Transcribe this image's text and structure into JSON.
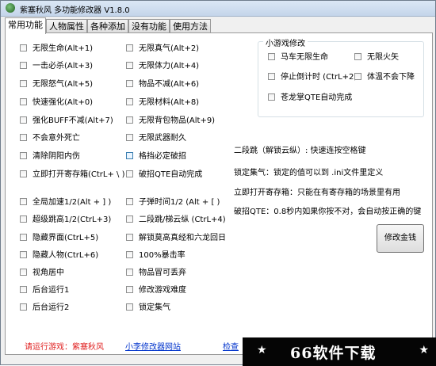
{
  "window": {
    "title": "紫塞秋风  多功能修改器  V1.8.0"
  },
  "tabs": [
    "常用功能",
    "人物属性",
    "各种添加",
    "没有功能",
    "使用方法"
  ],
  "col1": [
    "无限生命(Alt+1)",
    "一击必杀(Alt+3)",
    "无限怒气(Alt+5)",
    "快速强化(Alt+0)",
    "强化BUFF不减(Alt+7)",
    "不会意外死亡",
    "清除阴阳内伤",
    "立即打开寄存箱(CtrL+ \\ )"
  ],
  "col2": [
    "无限真气(Alt+2)",
    "无限体力(Alt+4)",
    "物品不减(Alt+6)",
    "无限材料(Alt+8)",
    "无限背包物品(Alt+9)",
    "无限武器耐久",
    "格挡必定破招",
    "破招QTE自动完成"
  ],
  "col3": [
    "全局加速1/2(Alt + ] )",
    "超级跳高1/2(CtrL+3)",
    "隐藏界面(CtrL+5)",
    "隐藏人物(CtrL+6)",
    "视角居中",
    "后台运行1",
    "后台运行2"
  ],
  "col4": [
    "子弹时间1/2 (Alt + [ )",
    "二段跳/梯云纵 (CtrL+4)",
    "解锁莫高真经和六龙回日",
    "100%暴击率",
    "物品冒可丢弃",
    "修改游戏难度",
    "锁定集气"
  ],
  "minigame": {
    "title": "小游戏修改",
    "items": [
      "马车无限生命",
      "无限火矢",
      "停止倒计时 (CtrL+2)",
      "体温不会下降",
      "苍龙掌QTE自动完成"
    ]
  },
  "info": [
    "二段跳（解锁云纵）: 快速连按空格键",
    "锁定集气：锁定的值可以到 .ini文件里定义",
    "立即打开寄存箱：只能在有寄存箱的场景里有用",
    "破招QTE：0.8秒内如果你按不对，会自动按正确的键"
  ],
  "buttons": {
    "modify_money": "修改金钱"
  },
  "footer": {
    "game_label": "请运行游戏：紫塞秋风",
    "site_link": "小李修改器网站",
    "update_link": "检查"
  },
  "watermark": {
    "text": "66软件下载",
    "star": "★"
  }
}
